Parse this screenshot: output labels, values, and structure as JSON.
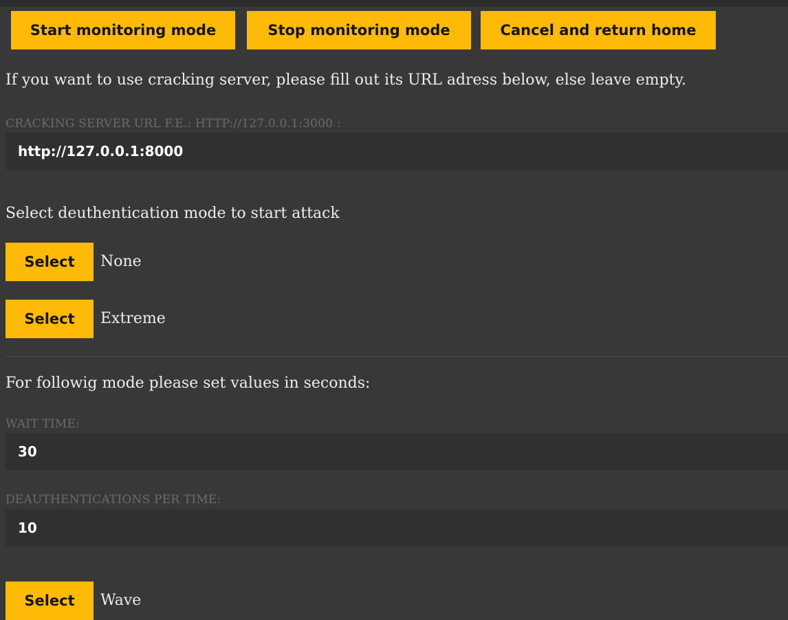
{
  "colors": {
    "background": "#383838",
    "accent": "#ffba08",
    "field_bg": "#303030",
    "label_muted": "#6b6b6b"
  },
  "toolbar": {
    "start_label": "Start monitoring mode",
    "stop_label": "Stop monitoring mode",
    "cancel_label": "Cancel and return home"
  },
  "server": {
    "intro": "If you want to use cracking server, please fill out its URL adress below, else leave empty.",
    "label": "CRACKING SERVER URL F.E.: HTTP://127.0.0.1:3000 :",
    "value": "http://127.0.0.1:8000"
  },
  "deauth": {
    "heading": "Select deuthentication mode to start attack",
    "select_label": "Select",
    "modes": [
      {
        "label": "None"
      },
      {
        "label": "Extreme"
      },
      {
        "label": "Wave"
      }
    ]
  },
  "timing": {
    "intro": "For followig mode please set values in seconds:",
    "wait_label": "WAIT TIME:",
    "wait_value": "30",
    "per_time_label": "DEAUTHENTICATIONS PER TIME:",
    "per_time_value": "10"
  }
}
